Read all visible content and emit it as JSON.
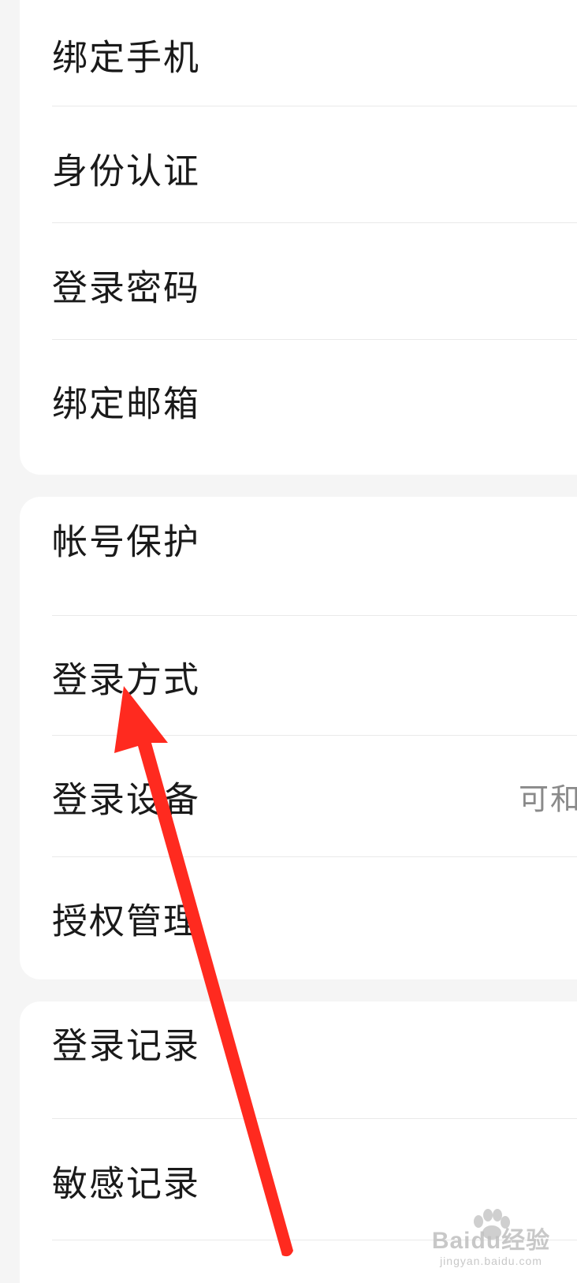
{
  "groups": [
    {
      "items": [
        {
          "label": "绑定手机"
        },
        {
          "label": "身份认证"
        },
        {
          "label": "登录密码"
        },
        {
          "label": "绑定邮箱"
        }
      ]
    },
    {
      "items": [
        {
          "label": "帐号保护"
        },
        {
          "label": "登录方式"
        },
        {
          "label": "登录设备",
          "value": "可和"
        },
        {
          "label": "授权管理"
        }
      ]
    },
    {
      "items": [
        {
          "label": "登录记录"
        },
        {
          "label": "敏感记录"
        }
      ]
    }
  ],
  "annotation": {
    "arrow_color": "#ff2a1f"
  },
  "watermark": {
    "main": "Baidu经验",
    "sub": "jingyan.baidu.com"
  }
}
